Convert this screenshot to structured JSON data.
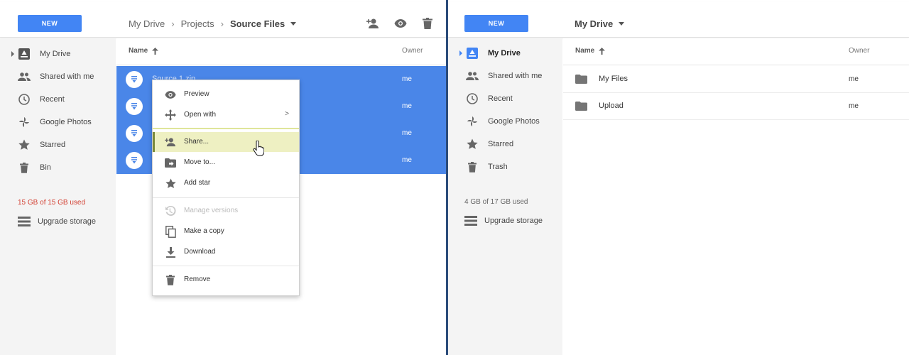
{
  "left": {
    "header": {
      "new_label": "NEW",
      "breadcrumb": [
        "My Drive",
        "Projects",
        "Source Files"
      ]
    },
    "sidebar": {
      "items": [
        {
          "label": "My Drive",
          "icon": "drive-icon"
        },
        {
          "label": "Shared with me",
          "icon": "people-icon"
        },
        {
          "label": "Recent",
          "icon": "clock-icon"
        },
        {
          "label": "Google Photos",
          "icon": "pinwheel-icon"
        },
        {
          "label": "Starred",
          "icon": "star-icon"
        },
        {
          "label": "Bin",
          "icon": "trash-icon"
        }
      ],
      "storage": "15 GB of 15 GB used",
      "storage_color": "#d23f31",
      "upgrade": "Upgrade storage"
    },
    "list": {
      "col_name": "Name",
      "col_owner": "Owner",
      "rows": [
        {
          "name": "Source 1.zip",
          "owner": "me"
        },
        {
          "name": "",
          "owner": "me"
        },
        {
          "name": "",
          "owner": "me"
        },
        {
          "name": "",
          "owner": "me"
        }
      ]
    },
    "context_menu": {
      "items": [
        {
          "label": "Preview",
          "icon": "eye-icon"
        },
        {
          "label": "Open with",
          "icon": "move-arrows-icon",
          "chevron": ">"
        },
        {
          "label": "Share...",
          "icon": "person-add-icon"
        },
        {
          "label": "Move to...",
          "icon": "folder-move-icon"
        },
        {
          "label": "Add star",
          "icon": "star-icon"
        },
        {
          "label": "Manage versions",
          "icon": "history-icon",
          "disabled": true
        },
        {
          "label": "Make a copy",
          "icon": "copy-icon"
        },
        {
          "label": "Download",
          "icon": "download-icon"
        },
        {
          "label": "Remove",
          "icon": "trash-icon"
        }
      ]
    }
  },
  "right": {
    "header": {
      "new_label": "NEW",
      "title": "My Drive"
    },
    "sidebar": {
      "items": [
        {
          "label": "My Drive",
          "icon": "drive-icon"
        },
        {
          "label": "Shared with me",
          "icon": "people-icon"
        },
        {
          "label": "Recent",
          "icon": "clock-icon"
        },
        {
          "label": "Google Photos",
          "icon": "pinwheel-icon"
        },
        {
          "label": "Starred",
          "icon": "star-icon"
        },
        {
          "label": "Trash",
          "icon": "trash-icon"
        }
      ],
      "storage": "4 GB of 17 GB used",
      "upgrade": "Upgrade storage"
    },
    "list": {
      "col_name": "Name",
      "col_owner": "Owner",
      "rows": [
        {
          "name": "My Files",
          "owner": "me"
        },
        {
          "name": "Upload",
          "owner": "me"
        }
      ]
    }
  },
  "colors": {
    "accent": "#4285f4",
    "selection": "#4a86e8",
    "sidebar_bg": "#f4f4f4",
    "menu_hover": "#eef0c2"
  }
}
